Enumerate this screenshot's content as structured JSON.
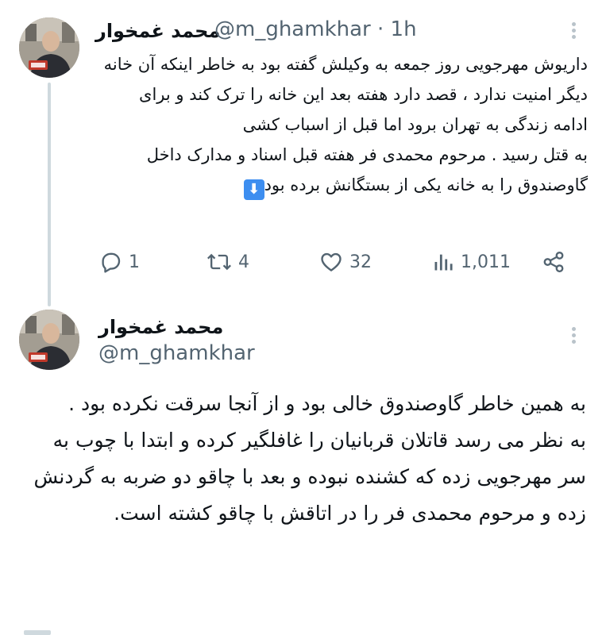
{
  "tweet1": {
    "author_name": "محمد غمخوار",
    "handle": "@m_ghamkhar",
    "separator": "·",
    "time": "1h",
    "paragraph1": "داریوش مهرجویی روز جمعه به وکیلش گفته بود به خاطر اینکه آن خانه دیگر امنیت ندارد ، قصد دارد هفته بعد این خانه را ترک کند و برای ادامه زندگی به تهران برود اما قبل از اسباب کشی",
    "paragraph2": "به قتل رسید . مرحوم محمدی فر هفته قبل اسناد و مدارک داخل گاوصندوق را به خانه یکی از بستگانش برده بود",
    "emoji": "⬇",
    "actions": {
      "replies": "1",
      "retweets": "4",
      "likes": "32",
      "views": "1,011"
    }
  },
  "tweet2": {
    "author_name": "محمد غمخوار",
    "handle": "@m_ghamkhar",
    "paragraph1": "به همین خاطر گاوصندوق خالی بود و از آنجا سرقت نکرده بود .",
    "paragraph2": "به نظر می رسد قاتلان قربانیان را غافلگیر کرده و ابتدا با چوب به سر مهرجویی زده که کشنده نبوده و بعد با چاقو دو ضربه به گردنش زده و مرحوم محمدی فر را در اتاقش با چاقو کشته است."
  },
  "icons": {
    "reply": "reply-icon",
    "retweet": "retweet-icon",
    "like": "heart-icon",
    "views": "views-bar-chart-icon",
    "share": "share-icon",
    "more": "more-icon"
  },
  "colors": {
    "text": "#0f1419",
    "secondary": "#536471",
    "thread_line": "#cfd9de",
    "emoji_blue": "#3d8ef0"
  }
}
